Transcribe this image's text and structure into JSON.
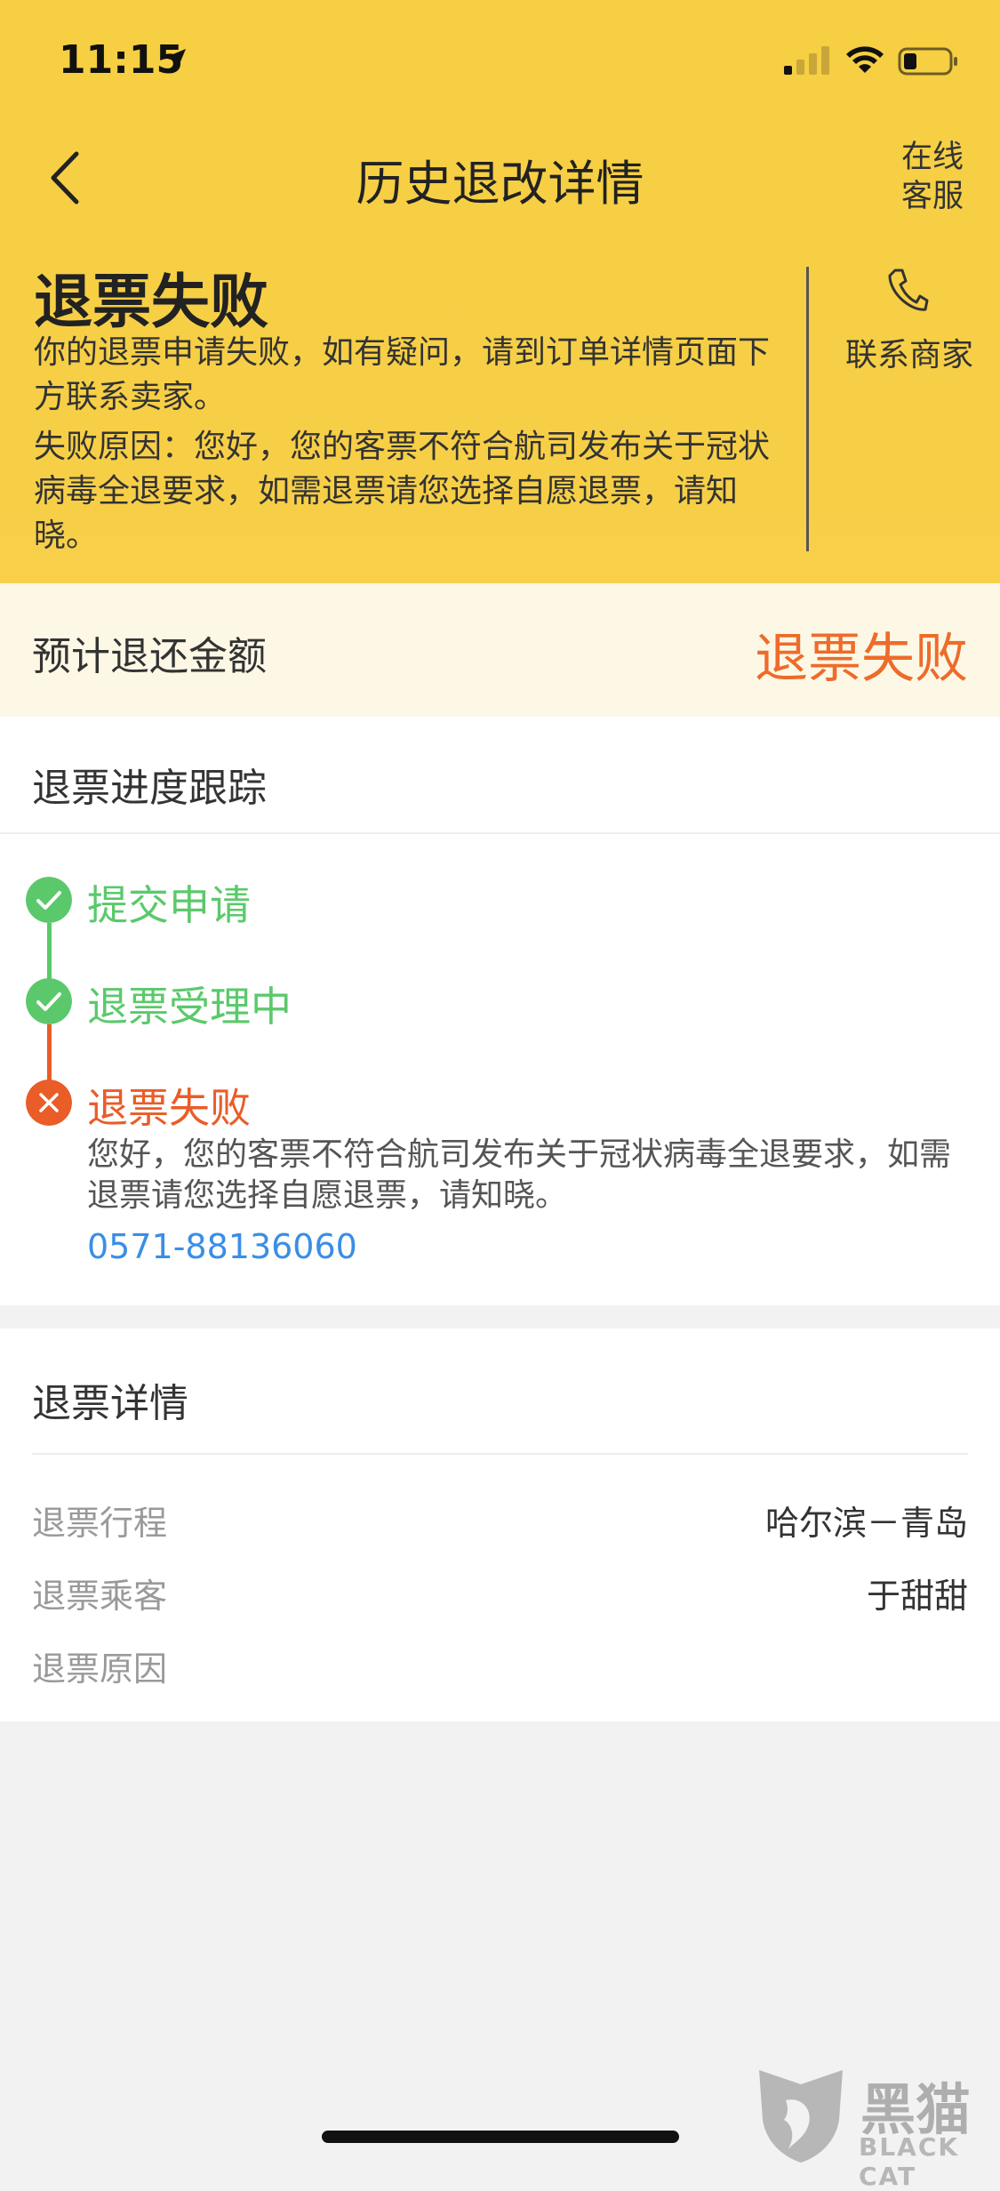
{
  "status_bar": {
    "time": "11:15"
  },
  "nav": {
    "title": "历史退改详情",
    "kefu_line1": "在线",
    "kefu_line2": "客服"
  },
  "fail_header": {
    "title": "退票失败",
    "desc": "你的退票申请失败，如有疑问，请到订单详情页面下方联系卖家。",
    "reason": "失败原因：您好，您的客票不符合航司发布关于冠状病毒全退要求，如需退票请您选择自愿退票，请知晓。",
    "contact_label": "联系商家"
  },
  "amount": {
    "label": "预计退还金额",
    "status": "退票失败"
  },
  "tracking": {
    "heading": "退票进度跟踪",
    "steps": [
      {
        "label": "提交申请",
        "state": "done"
      },
      {
        "label": "退票受理中",
        "state": "done"
      },
      {
        "label": "退票失败",
        "state": "failed"
      }
    ],
    "detail": "您好，您的客票不符合航司发布关于冠状病毒全退要求，如需退票请您选择自愿退票，请知晓。",
    "phone": "0571-88136060"
  },
  "details": {
    "heading": "退票详情",
    "rows": [
      {
        "key": "退票行程",
        "value": "哈尔滨－青岛"
      },
      {
        "key": "退票乘客",
        "value": "于甜甜"
      },
      {
        "key": "退票原因",
        "value": ""
      }
    ]
  },
  "watermark": {
    "line1": "黑猫",
    "line2": "BLACK CAT"
  },
  "colors": {
    "yellow": "#f6cf42",
    "green": "#5bc96b",
    "orange": "#ea5c28",
    "link": "#3a8ee6"
  }
}
